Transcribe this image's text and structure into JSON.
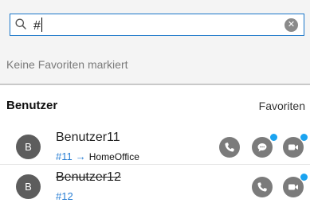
{
  "search": {
    "value": "#",
    "placeholder": ""
  },
  "favorites_panel": {
    "empty_text": "Keine Favoriten markiert"
  },
  "users_section": {
    "title": "Benutzer",
    "link_label": "Favoriten"
  },
  "users": [
    {
      "avatar_initial": "B",
      "name": "Benutzer11",
      "number": "#11",
      "arrow": "→",
      "status": "HomeOffice",
      "strikethrough": false
    },
    {
      "avatar_initial": "B",
      "name": "Benutzer12",
      "number": "#12",
      "strikethrough": true
    }
  ],
  "icons": {
    "search": "search-icon",
    "clear": "close-icon",
    "call": "phone-icon",
    "chat": "chat-icon",
    "video": "video-icon"
  },
  "colors": {
    "accent": "#1a76c9",
    "badge": "#1aa3f0",
    "action_gray": "#7b7b7b",
    "avatar_gray": "#5d5d5d",
    "link_blue": "#2a7fd4"
  }
}
